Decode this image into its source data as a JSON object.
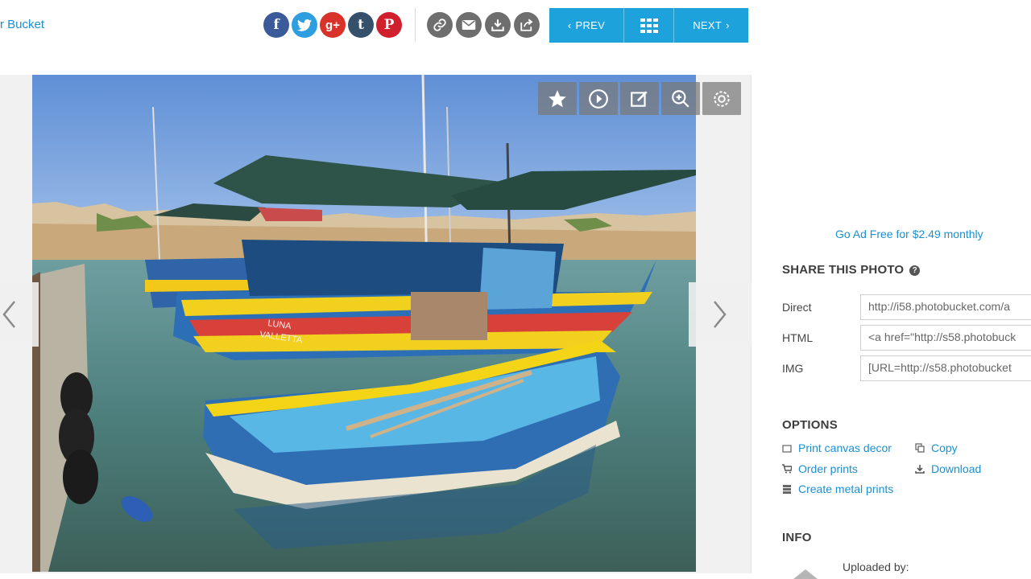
{
  "header": {
    "breadcrumb": "r Bucket",
    "social": [
      {
        "name": "facebook-icon",
        "glyph": "f"
      },
      {
        "name": "twitter-icon",
        "glyph": ""
      },
      {
        "name": "google-plus-icon",
        "glyph": "g+"
      },
      {
        "name": "tumblr-icon",
        "glyph": "t"
      },
      {
        "name": "pinterest-icon",
        "glyph": "P"
      }
    ],
    "tools": [
      "link-icon",
      "email-icon",
      "download-icon",
      "share-out-icon"
    ],
    "nav": {
      "prev_label": "PREV",
      "next_label": "NEXT",
      "grid_icon": "grid-icon"
    }
  },
  "photo": {
    "boat_text_line1": "LUNA",
    "boat_text_line2": "VALLETTA",
    "tools": [
      "star-icon",
      "play-icon",
      "edit-icon",
      "zoom-icon",
      "settings-icon"
    ]
  },
  "sidebar": {
    "ad_free": "Go Ad Free for $2.49 monthly",
    "share_title": "SHARE THIS PHOTO",
    "share_help": "?",
    "share_rows": [
      {
        "label": "Direct",
        "value": "http://i58.photobucket.com/a"
      },
      {
        "label": "HTML",
        "value": "<a href=\"http://s58.photobuck"
      },
      {
        "label": "IMG",
        "value": "[URL=http://s58.photobucket"
      }
    ],
    "options_title": "OPTIONS",
    "options": {
      "print_canvas": "Print canvas decor",
      "order_prints": "Order prints",
      "create_metal": "Create metal prints",
      "copy": "Copy",
      "download": "Download"
    },
    "info_title": "INFO",
    "uploaded_by": "Uploaded by:"
  },
  "colors": {
    "accent": "#1ea2dc",
    "link": "#1c8fd1",
    "facebook": "#3b5a9a",
    "twitter": "#2d9fe0",
    "google": "#d9322a",
    "tumblr": "#35506b",
    "pinterest": "#d0202e"
  }
}
